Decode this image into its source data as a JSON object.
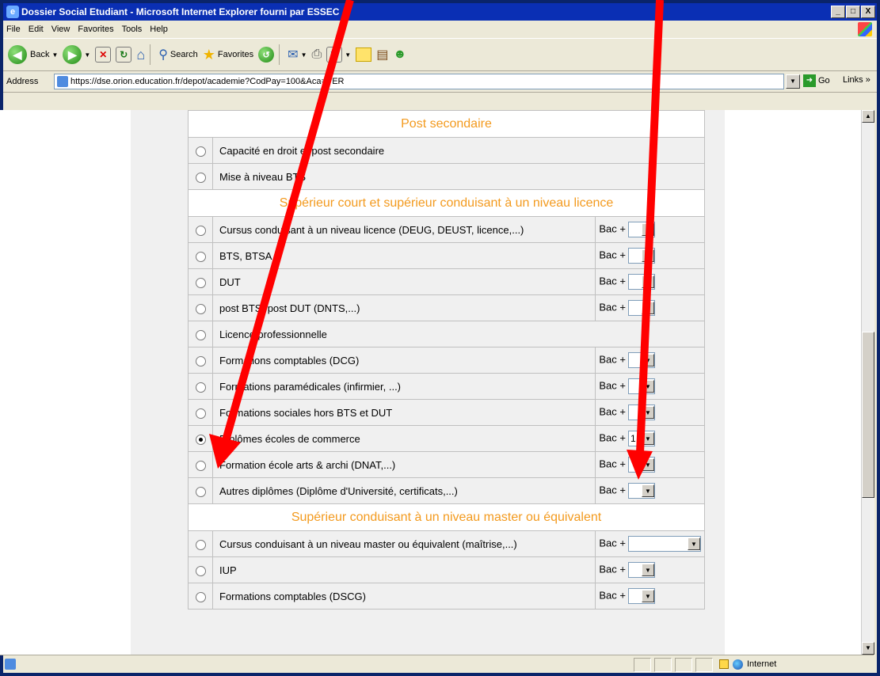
{
  "window": {
    "title": "Dossier Social Etudiant - Microsoft Internet Explorer fourni par ESSEC",
    "buttons": [
      "_",
      "□",
      "X"
    ]
  },
  "menubar": {
    "items": [
      "File",
      "Edit",
      "View",
      "Favorites",
      "Tools",
      "Help"
    ]
  },
  "toolbar": {
    "back_label": "Back",
    "search_label": "Search",
    "favorites_label": "Favorites"
  },
  "addressbar": {
    "label": "Address",
    "url": "https://dse.orion.education.fr/depot/academie?CodPay=100&Aca=VER",
    "go_label": "Go",
    "links_label": "Links"
  },
  "form": {
    "sections": [
      {
        "header": "Post secondaire",
        "rows": [
          {
            "label": "Capacité en droit et post secondaire",
            "has_bac": false,
            "selected": false
          },
          {
            "label": "Mise à niveau BTS",
            "has_bac": false,
            "selected": false
          }
        ]
      },
      {
        "header": "Supérieur court et supérieur conduisant à un niveau licence",
        "rows": [
          {
            "label": "Cursus conduisant à un niveau licence (DEUG, DEUST, licence,...)",
            "has_bac": true,
            "bac_label": "Bac +",
            "bac_value": "",
            "selected": false
          },
          {
            "label": "BTS, BTSA",
            "has_bac": true,
            "bac_label": "Bac +",
            "bac_value": "",
            "selected": false
          },
          {
            "label": "DUT",
            "has_bac": true,
            "bac_label": "Bac +",
            "bac_value": "",
            "selected": false
          },
          {
            "label": "post BTS, post DUT (DNTS,...)",
            "has_bac": true,
            "bac_label": "Bac +",
            "bac_value": "",
            "selected": false
          },
          {
            "label": "Licence professionnelle",
            "has_bac": false,
            "selected": false
          },
          {
            "label": "Formations comptables (DCG)",
            "has_bac": true,
            "bac_label": "Bac +",
            "bac_value": "",
            "selected": false
          },
          {
            "label": "Formations paramédicales (infirmier, ...)",
            "has_bac": true,
            "bac_label": "Bac +",
            "bac_value": "",
            "selected": false
          },
          {
            "label": "Formations sociales hors BTS et DUT",
            "has_bac": true,
            "bac_label": "Bac +",
            "bac_value": "",
            "selected": false
          },
          {
            "label": "Diplômes écoles de commerce",
            "has_bac": true,
            "bac_label": "Bac +",
            "bac_value": "1",
            "selected": true
          },
          {
            "label": "Formation école arts & archi (DNAT,...)",
            "has_bac": true,
            "bac_label": "Bac +",
            "bac_value": "",
            "selected": false
          },
          {
            "label": "Autres diplômes (Diplôme d'Université, certificats,...)",
            "has_bac": true,
            "bac_label": "Bac +",
            "bac_value": "",
            "selected": false
          }
        ]
      },
      {
        "header": "Supérieur conduisant à un niveau master ou équivalent",
        "rows": [
          {
            "label": "Cursus conduisant à un niveau master ou équivalent (maîtrise,...)",
            "has_bac": true,
            "bac_label": "Bac +",
            "bac_value": "",
            "selected": false,
            "wide": true
          },
          {
            "label": "IUP",
            "has_bac": true,
            "bac_label": "Bac +",
            "bac_value": "",
            "selected": false
          },
          {
            "label": "Formations comptables (DSCG)",
            "has_bac": true,
            "bac_label": "Bac +",
            "bac_value": "",
            "selected": false
          }
        ]
      }
    ]
  },
  "statusbar": {
    "zone_label": "Internet"
  },
  "annotation": {
    "arrow_color": "#ff0000"
  }
}
